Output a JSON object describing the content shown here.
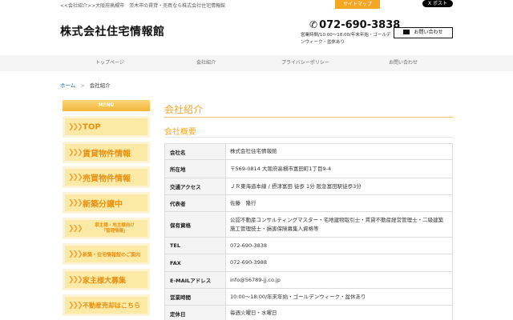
{
  "topbar": {
    "tagline": "<<会社紹介>>大阪府高槻市　茨木市の賃貸・売買なら株式会社住宅情報館",
    "sitemap": "サイトマップ",
    "x_post": "X ポスト"
  },
  "header": {
    "title": "株式会社住宅情報館",
    "phone": "072-690-3838",
    "hours": "営業時間/10:00～18:00/年末年始・ゴールデンウィーク・盆休あり",
    "contact": "お問い合わせ"
  },
  "nav": [
    "トップページ",
    "会社紹介",
    "プライバシーポリシー",
    "お問い合わせ"
  ],
  "breadcrumb": {
    "home": "ホーム",
    "sep": ">",
    "current": "会社紹介"
  },
  "sidebar": {
    "head": "MENU",
    "items": [
      {
        "label": "TOP"
      },
      {
        "label": "賃貸物件情報"
      },
      {
        "label": "売買物件情報"
      },
      {
        "label": "新築分譲中"
      },
      {
        "label": "家主様・地主様向け\n「管理情報」"
      },
      {
        "label": "新築・住宅情報館のご案内"
      },
      {
        "label": "家主様大募集"
      },
      {
        "label": "不動産売却はこちら"
      }
    ]
  },
  "main": {
    "heading": "会社紹介",
    "subheading": "会社概要",
    "rows": [
      {
        "k": "会社名",
        "v": "株式会社住宅情報館"
      },
      {
        "k": "所在地",
        "v": "〒569-0814 大阪府高槻市富田町1丁目9-4"
      },
      {
        "k": "交通アクセス",
        "v": "ＪＲ東海道本線 / 摂津富田 徒歩 1分 阪急富田駅徒歩3分"
      },
      {
        "k": "代表者",
        "v": "佐藤　隆行"
      },
      {
        "k": "保有資格",
        "v": "公認不動産コンサルティングマスター・宅地建物取引士・賃貸不動産経営管理士・二級建築施工管理技士・損害保険募集人資格等"
      },
      {
        "k": "TEL",
        "v": "072-690-3838"
      },
      {
        "k": "FAX",
        "v": "072-690-3988"
      },
      {
        "k": "E-MAILアドレス",
        "v": "info@56789-jj.co.jp"
      },
      {
        "k": "営業時間",
        "v": "10:00～18:00/年末年始・ゴールデンウィーク・盆休あり"
      },
      {
        "k": "定休日",
        "v": "毎週火曜日・水曜日"
      }
    ]
  },
  "colors": {
    "accent": "#f5a623",
    "menu_bg": "#fbeaa5",
    "link": "#1a6bb5"
  }
}
